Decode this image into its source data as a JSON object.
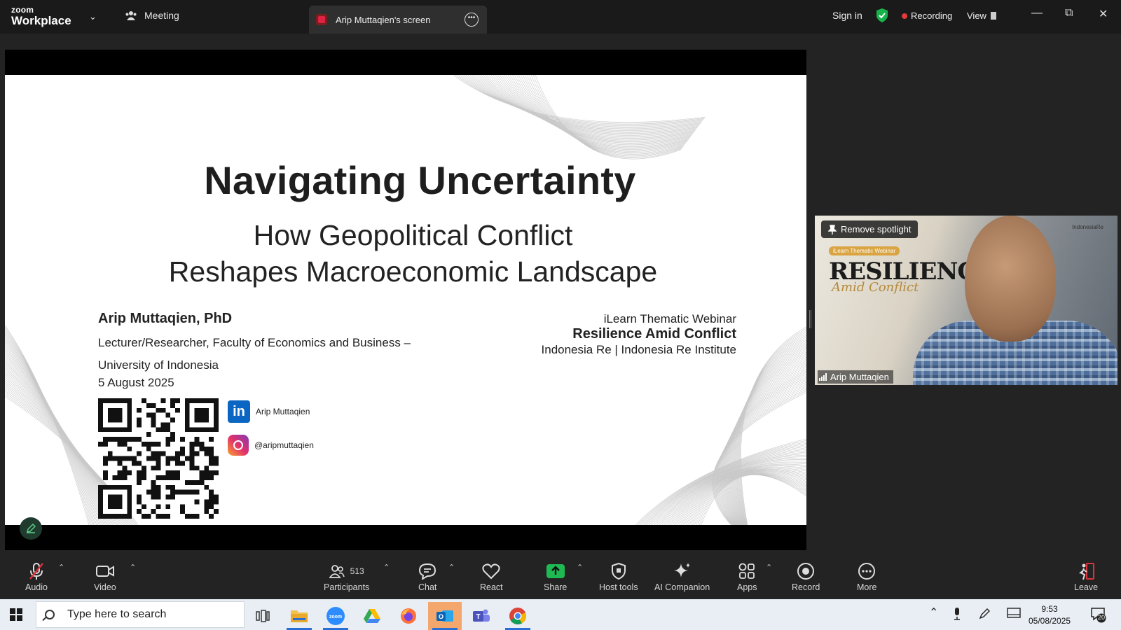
{
  "app": {
    "logo_line1": "zoom",
    "logo_line2": "Workplace"
  },
  "tabs": {
    "meeting": "Meeting",
    "screen": "Arip Muttaqien's screen"
  },
  "topbar": {
    "signin": "Sign in",
    "recording": "Recording",
    "view": "View",
    "recording_color": "#e23b3b",
    "shield_color": "#17b34a"
  },
  "slide": {
    "title": "Navigating Uncertainty",
    "subtitle_line1": "How Geopolitical Conflict",
    "subtitle_line2": "Reshapes Macroeconomic Landscape",
    "author": "Arip Muttaqien, PhD",
    "affiliation_line1": "Lecturer/Researcher, Faculty of Economics and Business –",
    "affiliation_line2": "University of Indonesia",
    "date": "5 August 2025",
    "event_line1": "iLearn Thematic Webinar",
    "event_line2": "Resilience Amid Conflict",
    "event_line3": "Indonesia Re | Indonesia Re Institute",
    "linkedin": "Arip Muttaqien",
    "instagram": "@aripmuttaqien"
  },
  "video": {
    "spotlight_button": "Remove spotlight",
    "participant_name": "Arip Muttaqien",
    "background_banner": "iLearn Thematic Webinar",
    "background_title": "RESILIENC",
    "background_script": "Amid Conflict",
    "background_logos": "IndonesiaRe"
  },
  "toolbar": {
    "audio": "Audio",
    "video": "Video",
    "participants": "Participants",
    "participants_count": "513",
    "chat": "Chat",
    "react": "React",
    "share": "Share",
    "host_tools": "Host tools",
    "ai_companion": "AI Companion",
    "apps": "Apps",
    "record": "Record",
    "more": "More",
    "leave": "Leave"
  },
  "taskbar": {
    "search_placeholder": "Type here to search",
    "time": "9:53",
    "date": "05/08/2025",
    "notifications": "20",
    "apps": [
      "task-view",
      "file-explorer",
      "zoom",
      "google-drive",
      "firefox",
      "outlook",
      "teams",
      "chrome"
    ]
  }
}
